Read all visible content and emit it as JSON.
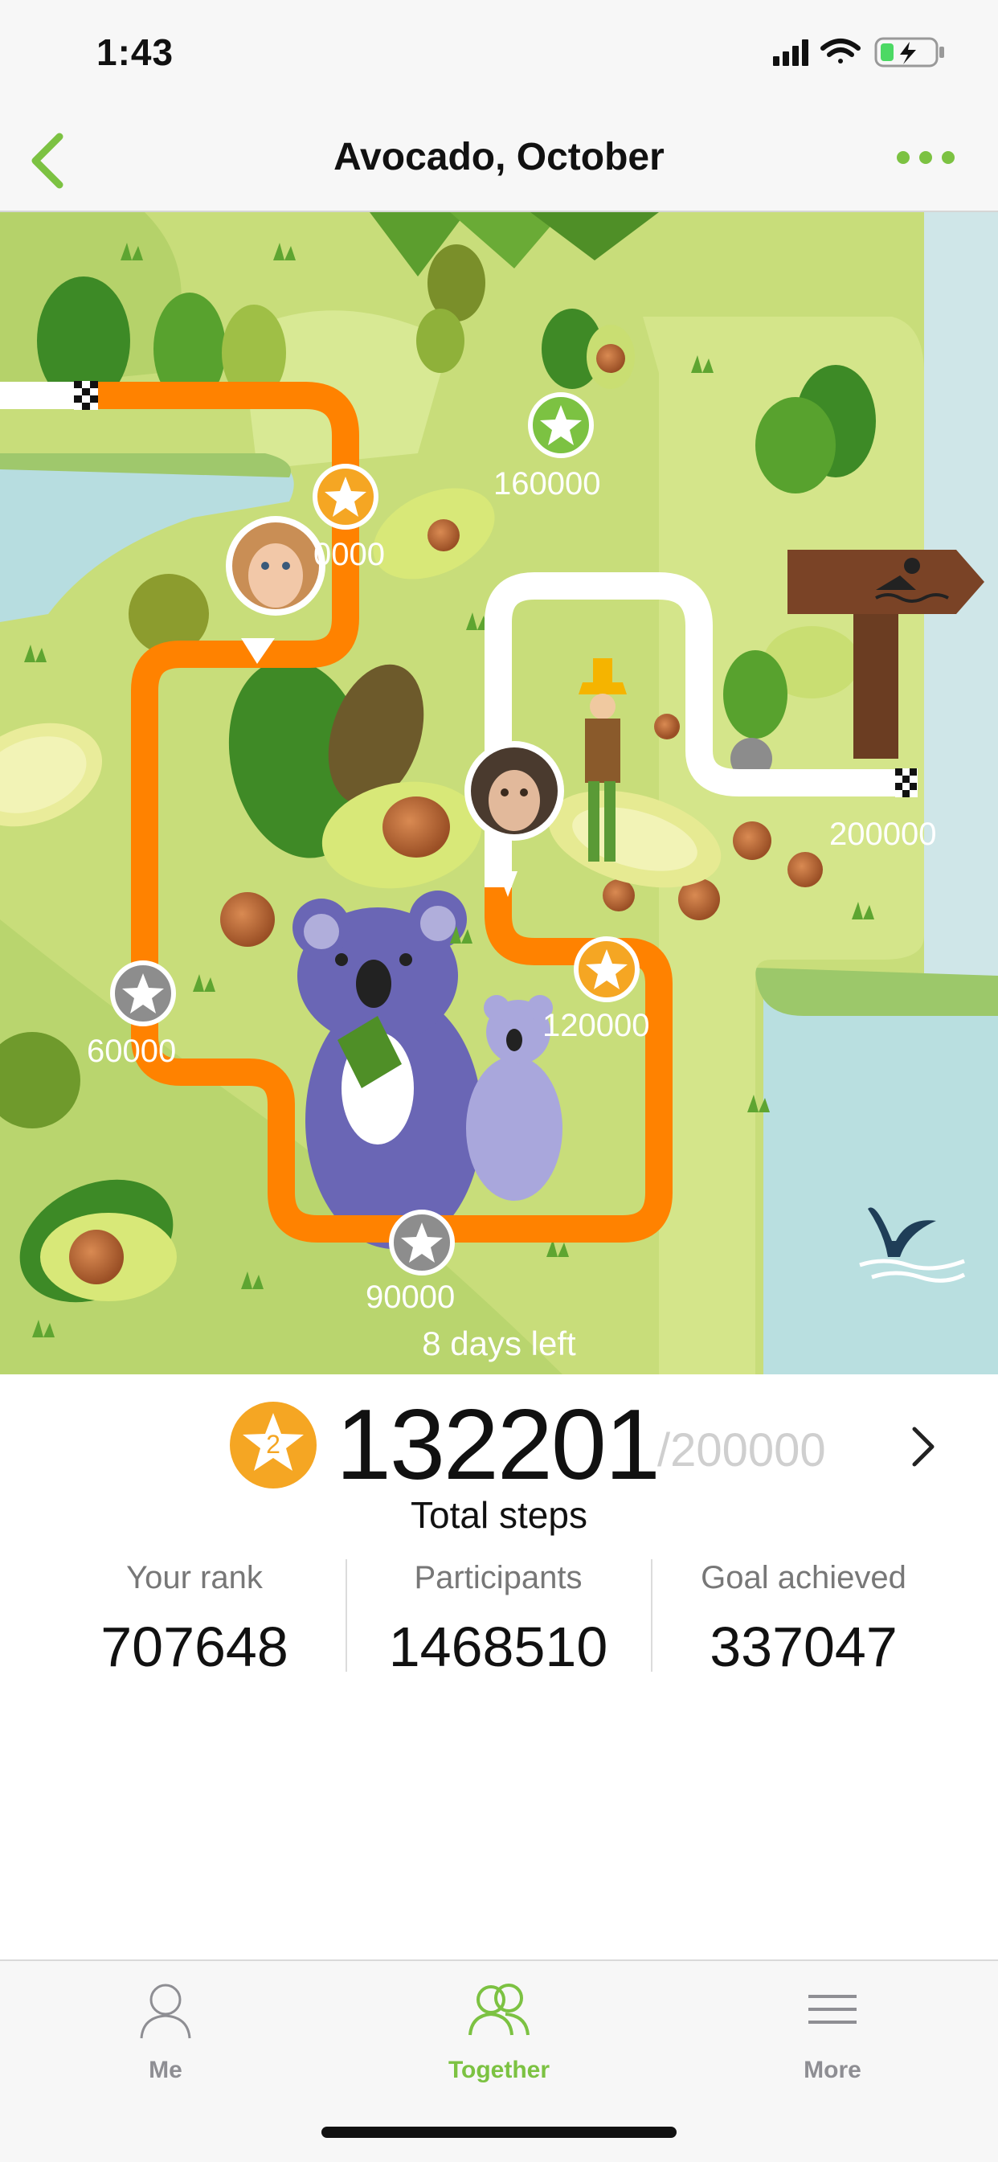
{
  "status_bar": {
    "time": "1:43"
  },
  "nav": {
    "title": "Avocado, October"
  },
  "map": {
    "milestones": [
      {
        "label": "160000",
        "state": "reached"
      },
      {
        "label": "0000",
        "state": "reached"
      },
      {
        "label": "60000",
        "state": "reached"
      },
      {
        "label": "90000",
        "state": "reached"
      },
      {
        "label": "120000",
        "state": "current"
      },
      {
        "label": "200000",
        "state": "goal"
      }
    ],
    "days_left": "8 days left"
  },
  "summary": {
    "medal_number": "2",
    "total_steps": "132201",
    "goal": "/200000",
    "total_label": "Total steps"
  },
  "stats": [
    {
      "label": "Your rank",
      "value": "707648"
    },
    {
      "label": "Participants",
      "value": "1468510"
    },
    {
      "label": "Goal achieved",
      "value": "337047"
    }
  ],
  "tabs": [
    {
      "label": "Me",
      "active": false
    },
    {
      "label": "Together",
      "active": true
    },
    {
      "label": "More",
      "active": false
    }
  ],
  "colors": {
    "accent": "#7cc242",
    "route": "#ff8200",
    "star": "#f5a623"
  }
}
